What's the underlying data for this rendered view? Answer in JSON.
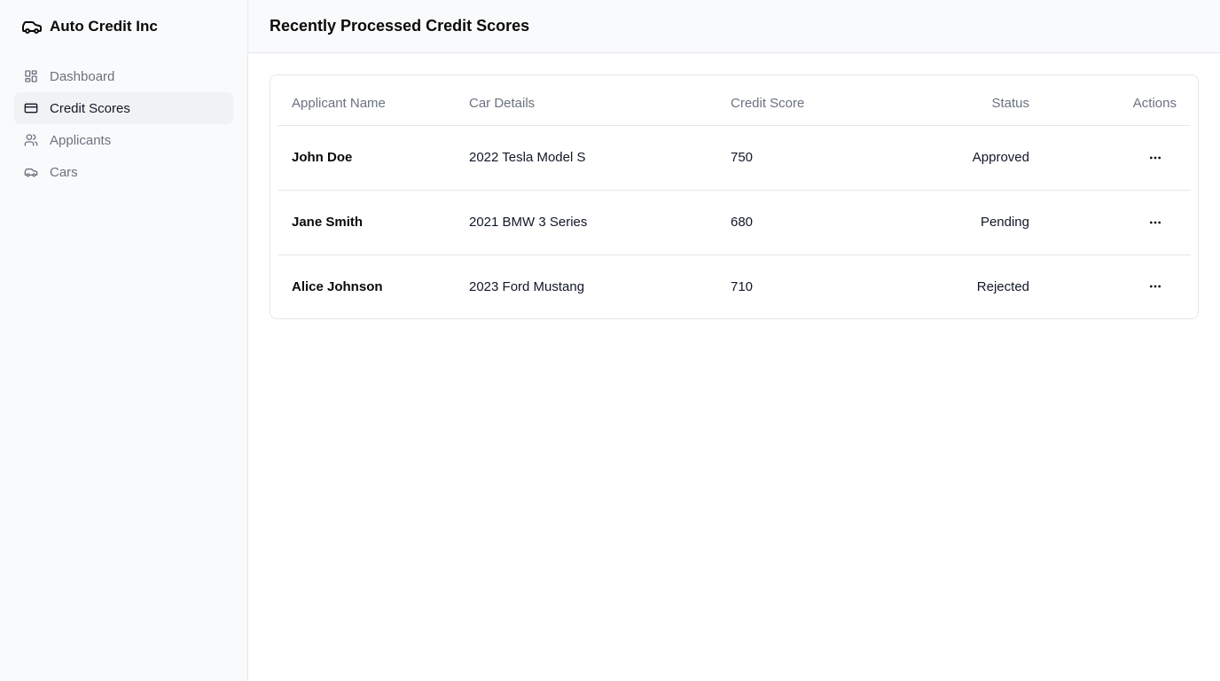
{
  "app": {
    "name": "Auto Credit Inc",
    "logo_icon": "car-icon"
  },
  "sidebar": {
    "items": [
      {
        "label": "Dashboard",
        "icon": "dashboard-icon",
        "active": false
      },
      {
        "label": "Credit Scores",
        "icon": "credit-card-icon",
        "active": true
      },
      {
        "label": "Applicants",
        "icon": "users-icon",
        "active": false
      },
      {
        "label": "Cars",
        "icon": "car-icon",
        "active": false
      }
    ]
  },
  "header": {
    "title": "Recently Processed Credit Scores"
  },
  "table": {
    "columns": [
      "Applicant Name",
      "Car Details",
      "Credit Score",
      "Status",
      "Actions"
    ],
    "rows": [
      {
        "name": "John Doe",
        "car": "2022 Tesla Model S",
        "score": "750",
        "status": "Approved",
        "action_icon": "more-horizontal-icon"
      },
      {
        "name": "Jane Smith",
        "car": "2021 BMW 3 Series",
        "score": "680",
        "status": "Pending",
        "action_icon": "more-horizontal-icon"
      },
      {
        "name": "Alice Johnson",
        "car": "2023 Ford Mustang",
        "score": "710",
        "status": "Rejected",
        "action_icon": "more-horizontal-icon"
      }
    ]
  },
  "colors": {
    "sidebar_bg": "#f9fafb",
    "border": "#e5e7eb",
    "muted_text": "#6b7280",
    "active_item_bg": "#f1f2f4"
  }
}
